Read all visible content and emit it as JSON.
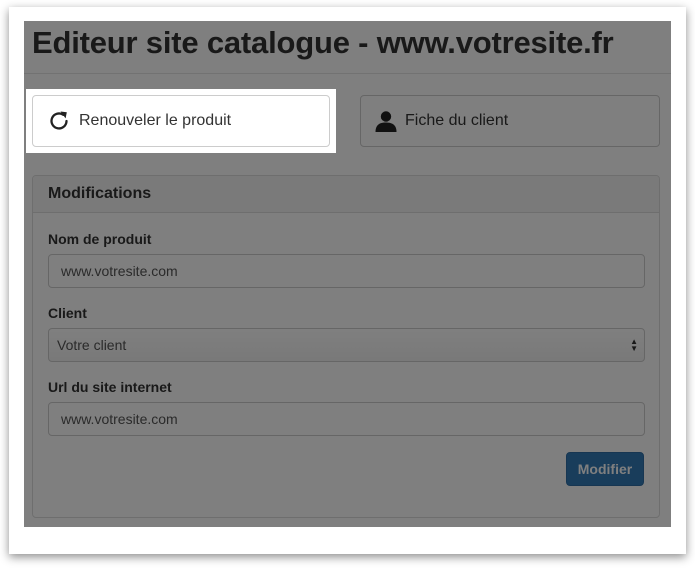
{
  "page": {
    "title": "Editeur site catalogue - www.votresite.fr"
  },
  "actions": {
    "renew": {
      "label": "Renouveler le produit",
      "icon": "refresh-icon"
    },
    "client": {
      "label": "Fiche du client",
      "icon": "user-icon"
    }
  },
  "panel": {
    "heading": "Modifications",
    "fields": {
      "product_name": {
        "label": "Nom de produit",
        "value": "www.votresite.com"
      },
      "client": {
        "label": "Client",
        "value": "Votre client"
      },
      "url": {
        "label": "Url du site internet",
        "value": "www.votresite.com"
      }
    },
    "submit_label": "Modifier"
  },
  "colors": {
    "primary": "#337ab7",
    "overlay": "rgba(0,0,0,0.5)"
  }
}
